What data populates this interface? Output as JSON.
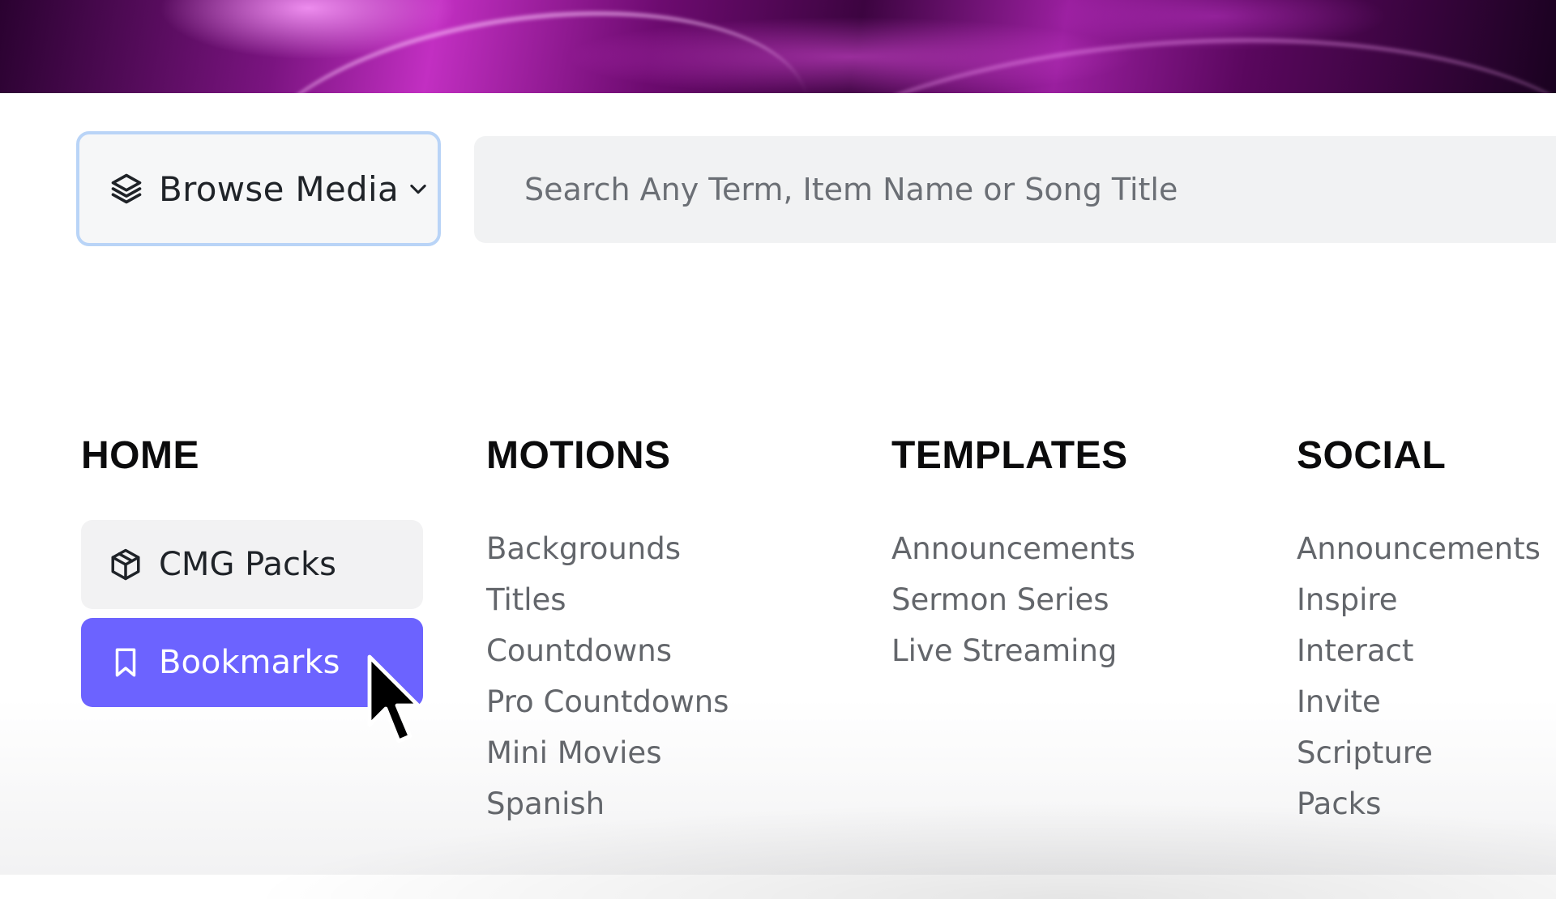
{
  "banner": {
    "description_colors": [
      "#2a0230",
      "#c22fc2",
      "#9a1f9f",
      "#1a0220"
    ]
  },
  "toolbar": {
    "browse_label": "Browse Media",
    "browse_icon": "layers-icon",
    "chevron_icon": "chevron-down-icon",
    "search_placeholder": "Search Any Term, Item Name or Song Title",
    "search_value": ""
  },
  "menu": {
    "home": {
      "title": "HOME",
      "items": [
        {
          "label": "CMG Packs",
          "icon": "package-icon"
        },
        {
          "label": "Bookmarks",
          "icon": "bookmark-icon",
          "active": true
        }
      ]
    },
    "motions": {
      "title": "MOTIONS",
      "items": [
        "Backgrounds",
        "Titles",
        "Countdowns",
        "Pro Countdowns",
        "Mini Movies",
        "Spanish"
      ]
    },
    "templates": {
      "title": "TEMPLATES",
      "items": [
        "Announcements",
        "Sermon Series",
        "Live Streaming"
      ]
    },
    "social": {
      "title": "SOCIAL",
      "items": [
        "Announcements",
        "Inspire",
        "Interact",
        "Invite",
        "Scripture",
        "Packs"
      ]
    }
  },
  "colors": {
    "accent": "#6c63ff",
    "focus_ring": "#b9d4f7",
    "menu_text": "#63666b",
    "heading": "#0b0b0c"
  }
}
